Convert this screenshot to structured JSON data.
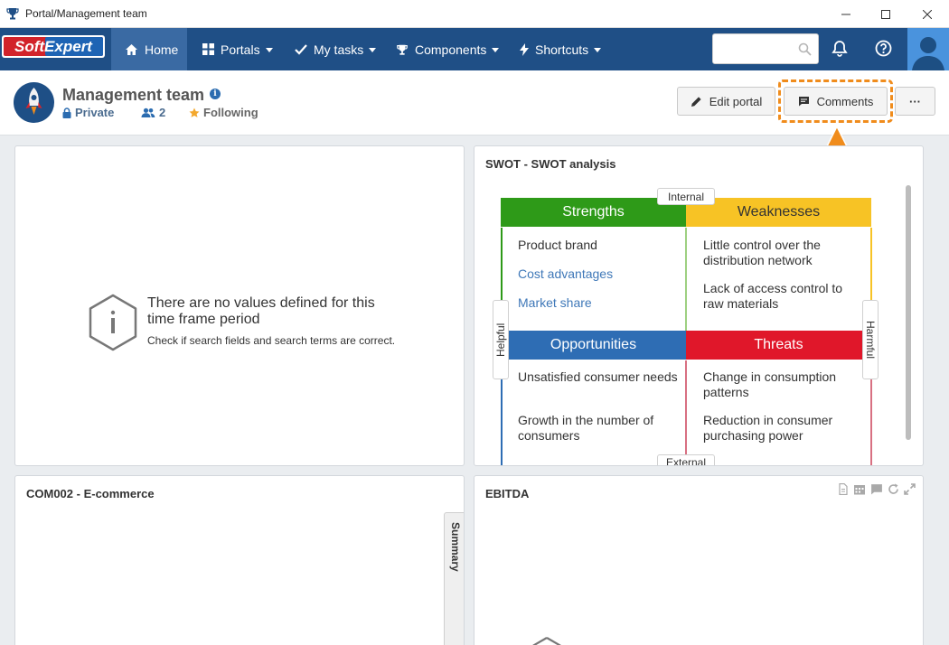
{
  "window": {
    "title": "Portal/Management team"
  },
  "nav": {
    "logo_text": "SoftExpert",
    "home": "Home",
    "portals": "Portals",
    "my_tasks": "My tasks",
    "components": "Components",
    "shortcuts": "Shortcuts",
    "search_placeholder": ""
  },
  "header": {
    "title": "Management team",
    "privacy": "Private",
    "members": "2",
    "following": "Following",
    "edit_portal": "Edit portal",
    "comments": "Comments",
    "more": "···"
  },
  "panels": {
    "empty": {
      "title": "There are no values defined for this time frame period",
      "subtitle": "Check if search fields and search terms are correct."
    },
    "swot": {
      "title": "SWOT - SWOT analysis",
      "internal": "Internal",
      "external": "External",
      "helpful": "Helpful",
      "harmful": "Harmful",
      "strengths": {
        "label": "Strengths",
        "items": [
          "Product brand",
          "Cost advantages",
          "Market share"
        ]
      },
      "weaknesses": {
        "label": "Weaknesses",
        "items": [
          "Little control over the distribution network",
          "Lack of access control to raw materials"
        ]
      },
      "opportunities": {
        "label": "Opportunities",
        "items": [
          "Unsatisfied consumer needs",
          "Growth in the number of consumers"
        ]
      },
      "threats": {
        "label": "Threats",
        "items": [
          "Change in consumption patterns",
          "Reduction in consumer purchasing power"
        ]
      }
    },
    "ecommerce": {
      "title": "COM002 - E-commerce",
      "summary_tab": "Summary"
    },
    "ebitda": {
      "title": "EBITDA"
    }
  },
  "colors": {
    "nav_bg": "#1f4f86",
    "nav_active": "#3a6aa3",
    "strengths": "#2e9a18",
    "weaknesses": "#f7c325",
    "opportunities": "#2e6db4",
    "threats": "#e0172a",
    "highlight": "#f08c1c"
  }
}
